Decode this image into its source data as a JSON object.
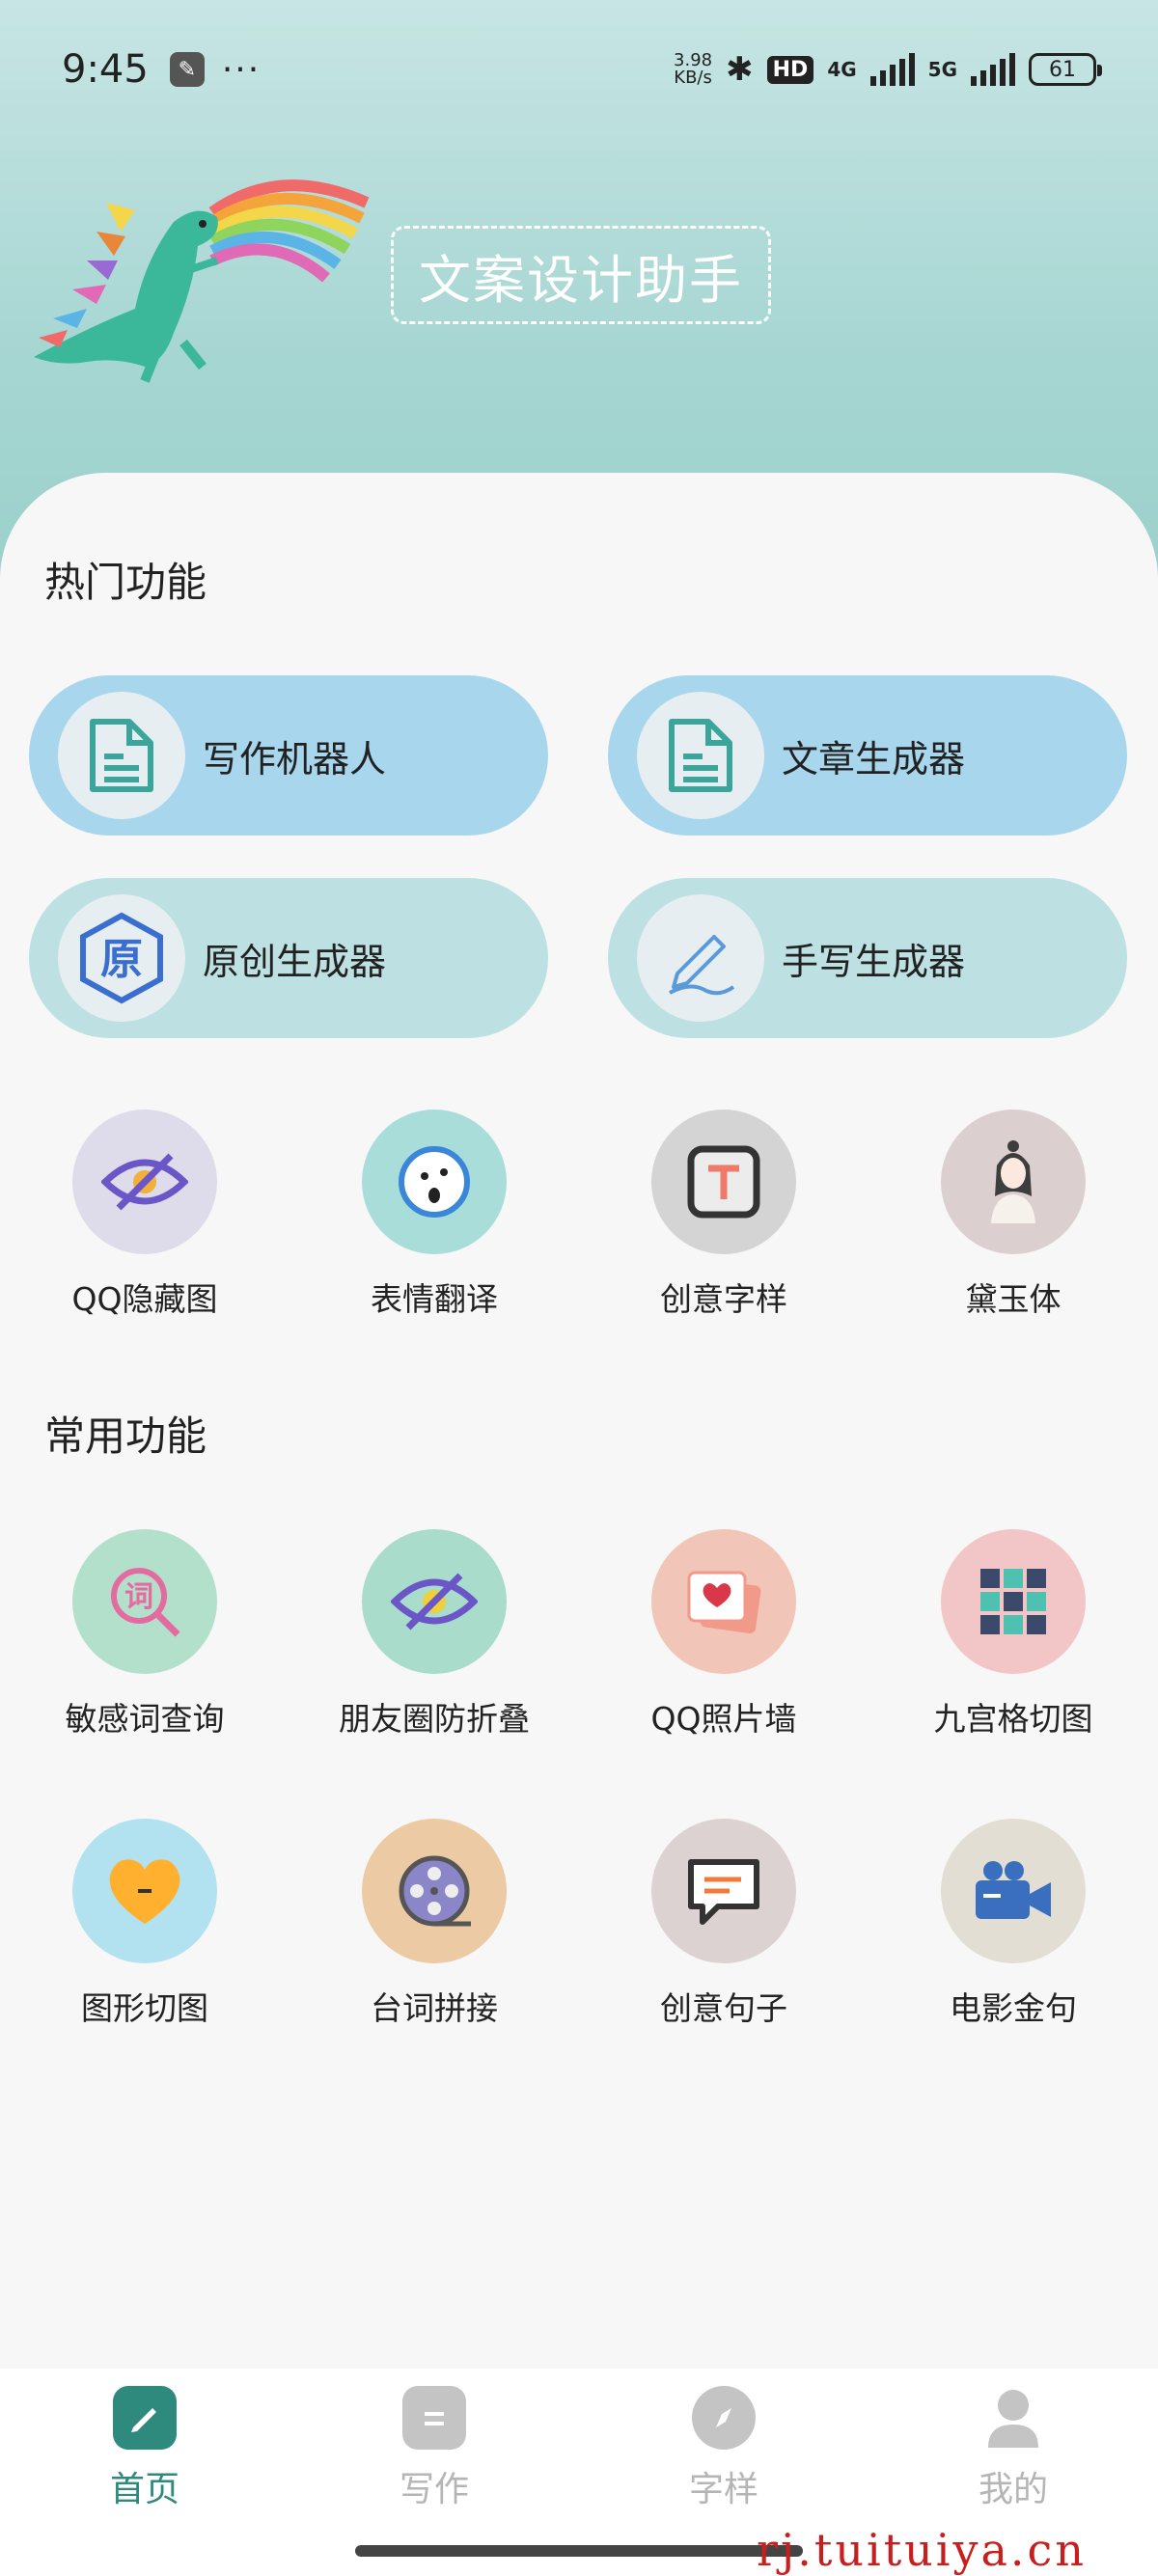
{
  "status_bar": {
    "time": "9:45",
    "dots": "···",
    "net_speed_value": "3.98",
    "net_speed_unit": "KB/s",
    "hd_badge": "HD",
    "net_4g": "4G",
    "net_5g": "5G",
    "battery": "61"
  },
  "app": {
    "title": "文案设计助手"
  },
  "hot": {
    "title": "热门功能",
    "pills": [
      {
        "label": "写作机器人",
        "icon": "document-icon",
        "bg": "#a8d6ec"
      },
      {
        "label": "文章生成器",
        "icon": "document-icon",
        "bg": "#a8d6ec"
      },
      {
        "label": "原创生成器",
        "icon": "original-icon",
        "bg": "#bde0e3"
      },
      {
        "label": "手写生成器",
        "icon": "pen-icon",
        "bg": "#bde0e3"
      }
    ],
    "items": [
      {
        "label": "QQ隐藏图",
        "icon": "eye-slash-icon",
        "bg": "#dedbea"
      },
      {
        "label": "表情翻译",
        "icon": "emoji-icon",
        "bg": "#a8ddd9"
      },
      {
        "label": "创意字样",
        "icon": "text-t-icon",
        "bg": "#d5d4d4"
      },
      {
        "label": "黛玉体",
        "icon": "lady-icon",
        "bg": "#dccfcf"
      }
    ]
  },
  "common": {
    "title": "常用功能",
    "items": [
      {
        "label": "敏感词查询",
        "icon": "word-search-icon",
        "bg": "#b3e0cb"
      },
      {
        "label": "朋友圈防折叠",
        "icon": "eye-slash-icon",
        "bg": "#a9dccb"
      },
      {
        "label": "QQ照片墙",
        "icon": "photo-heart-icon",
        "bg": "#f1c6b8"
      },
      {
        "label": "九宫格切图",
        "icon": "grid-icon",
        "bg": "#f2c6c6"
      },
      {
        "label": "图形切图",
        "icon": "heart-icon",
        "bg": "#b2e1ef"
      },
      {
        "label": "台词拼接",
        "icon": "film-reel-icon",
        "bg": "#eccaa4"
      },
      {
        "label": "创意句子",
        "icon": "chat-icon",
        "bg": "#ddd2d2"
      },
      {
        "label": "电影金句",
        "icon": "video-camera-icon",
        "bg": "#e3ded4"
      }
    ]
  },
  "bottom_nav": [
    {
      "label": "首页",
      "active": true
    },
    {
      "label": "写作",
      "active": false
    },
    {
      "label": "字样",
      "active": false
    },
    {
      "label": "我的",
      "active": false
    }
  ],
  "colors": {
    "accent": "#2e8a7c",
    "nav_inactive": "#b5b5b5"
  },
  "watermark": "rj.tuituiya.cn"
}
